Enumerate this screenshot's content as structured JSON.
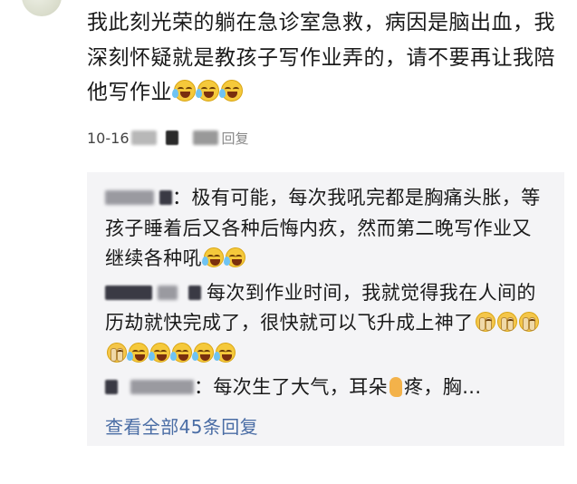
{
  "comment": {
    "text": "我此刻光荣的躺在急诊室急救，病因是脑出血，我深刻怀疑就是教孩子写作业弄的，请不要再让我陪他写作业",
    "emojis": [
      "laugh-cry-emoji",
      "laugh-cry-emoji",
      "laugh-cry-emoji"
    ]
  },
  "meta": {
    "date": "10-16",
    "reply_label": "回复"
  },
  "replies": [
    {
      "text": "：极有可能，每次我吼完都是胸痛头胀，等孩子睡着后又各种后悔内疚，然而第二晚写作业又继续各种吼",
      "emojis": [
        "laugh-cry-emoji",
        "laugh-cry-emoji"
      ]
    },
    {
      "text": "每次到作业时间，我就觉得我在人间的历劫就快完成了，很快就可以飞升成上神了",
      "emojis": [
        "covering-face-emoji",
        "covering-face-emoji",
        "covering-face-emoji",
        "covering-face-emoji",
        "laugh-cry-emoji",
        "laugh-cry-emoji",
        "laugh-cry-emoji",
        "laugh-cry-emoji",
        "laugh-cry-emoji"
      ]
    },
    {
      "text_before": "：每次生了大气，耳朵",
      "text_after": "疼，胸...",
      "icon": "ear-icon"
    }
  ],
  "view_all": "查看全部45条回复",
  "colors": {
    "link": "#4a6da5",
    "reply_bg": "#f4f4f6"
  }
}
